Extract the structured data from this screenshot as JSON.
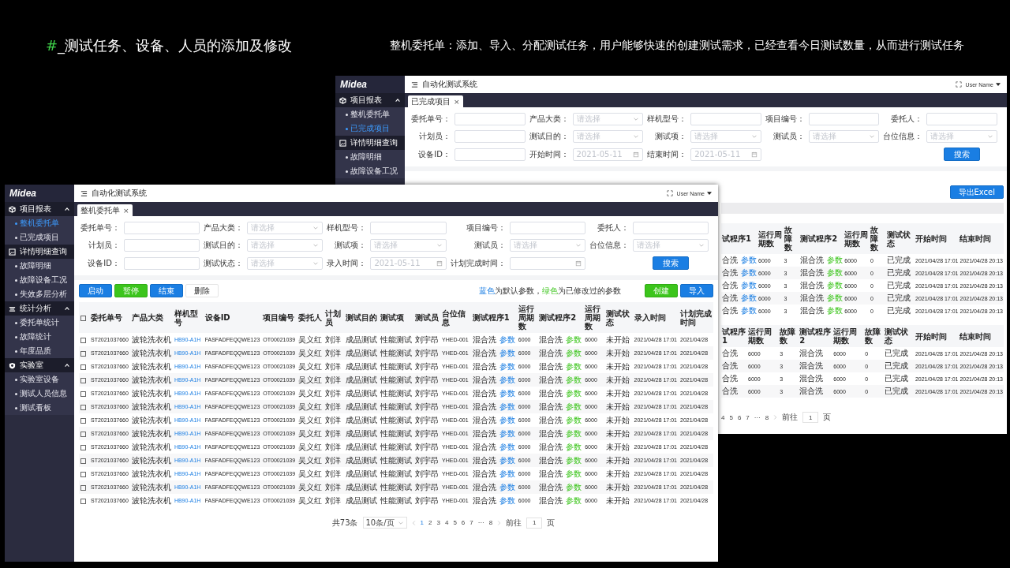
{
  "slide": {
    "title": {
      "mark": "#",
      "text": "_测试任务、设备、人员的添加及修改"
    },
    "description": "整机委托单：添加、导入、分配测试任务，用户能够快速的创建测试需求，已经查看今日测试数量，从而进行测试任务"
  },
  "windows": [
    {
      "kind": "back",
      "logo": "Midea",
      "title": "自动化测试系统",
      "user": "User Name",
      "tab": {
        "label": "已完成项目",
        "close": "×"
      },
      "sidebar": [
        {
          "label": "项目报表",
          "expanded": true,
          "children": [
            {
              "label": "整机委托单",
              "selected": false
            },
            {
              "label": "已完成项目",
              "selected": true
            }
          ]
        },
        {
          "label": "详情明细查询",
          "expanded": true,
          "children": [
            {
              "label": "故障明细",
              "selected": false
            },
            {
              "label": "故障设备工况",
              "selected": false
            }
          ]
        }
      ],
      "form": [
        [
          {
            "label": "委托单号：",
            "kind": "input"
          },
          {
            "label": "产品大类：",
            "kind": "select",
            "placeholder": "请选择"
          },
          {
            "label": "样机型号：",
            "kind": "input"
          },
          {
            "label": "项目编号：",
            "kind": "input"
          },
          {
            "label": "委托人：",
            "kind": "input"
          }
        ],
        [
          {
            "label": "计划员：",
            "kind": "input"
          },
          {
            "label": "测试目的：",
            "kind": "select",
            "placeholder": "请选择"
          },
          {
            "label": "测试项：",
            "kind": "select",
            "placeholder": "请选择"
          },
          {
            "label": "测试员：",
            "kind": "select",
            "placeholder": "请选择"
          },
          {
            "label": "台位信息：",
            "kind": "select",
            "placeholder": "请选择"
          }
        ],
        [
          {
            "label": "设备ID：",
            "kind": "input"
          },
          {
            "label": "开始时间：",
            "kind": "date",
            "placeholder": "2021-05-11"
          },
          {
            "label": "结束时间：",
            "kind": "date",
            "placeholder": "2021-05-11"
          },
          {
            "kind": "blank"
          },
          {
            "label": "搜索",
            "kind": "button"
          }
        ]
      ],
      "export_button": {
        "label": "导出Excel",
        "kind": "primary"
      },
      "tables": [
        {
          "columns": [
            {
              "label": "试程序1",
              "kind": "program"
            },
            {
              "label": "运行周期数",
              "kind": "code"
            },
            {
              "label": "故障数",
              "kind": "code"
            },
            {
              "label": "测试程序2",
              "kind": "program"
            },
            {
              "label": "运行周期数",
              "kind": "code"
            },
            {
              "label": "故障数",
              "kind": "code"
            },
            {
              "label": "测试状态",
              "kind": "text"
            },
            {
              "label": "开始时间",
              "kind": "code"
            },
            {
              "label": "结束时间",
              "kind": "code"
            }
          ],
          "rows": [
            {
              "cells": [
                {
                  "name": "合洗",
                  "param": "参数",
                  "modified": false
                },
                "6000",
                "3",
                {
                  "name": "混合洗",
                  "param": "参数",
                  "modified": true
                },
                "6000",
                "0",
                "已完成",
                "2021/04/28 17:01",
                "2021/04/28 20:13"
              ]
            },
            {
              "cells": [
                {
                  "name": "合洗",
                  "param": "参数",
                  "modified": false
                },
                "6000",
                "3",
                {
                  "name": "混合洗",
                  "param": "参数",
                  "modified": true
                },
                "6000",
                "0",
                "已完成",
                "2021/04/28 17:01",
                "2021/04/28 20:13"
              ]
            },
            {
              "cells": [
                {
                  "name": "合洗",
                  "param": "参数",
                  "modified": false
                },
                "6000",
                "3",
                {
                  "name": "混合洗",
                  "param": "参数",
                  "modified": true
                },
                "6000",
                "0",
                "已完成",
                "2021/04/28 17:01",
                "2021/04/28 20:13"
              ]
            },
            {
              "cells": [
                {
                  "name": "合洗",
                  "param": "参数",
                  "modified": false
                },
                "6000",
                "3",
                {
                  "name": "混合洗",
                  "param": "参数",
                  "modified": true
                },
                "6000",
                "0",
                "已完成",
                "2021/04/28 17:01",
                "2021/04/28 20:13"
              ]
            },
            {
              "cells": [
                {
                  "name": "合洗",
                  "param": "参数",
                  "modified": false
                },
                "6000",
                "3",
                {
                  "name": "混合洗",
                  "param": "参数",
                  "modified": true
                },
                "6000",
                "0",
                "已完成",
                "2021/04/28 17:01",
                "2021/04/28 20:13"
              ]
            }
          ]
        },
        {
          "columns": [
            {
              "label": "试程序1",
              "kind": "text"
            },
            {
              "label": "运行周期数",
              "kind": "code"
            },
            {
              "label": "故障数",
              "kind": "code"
            },
            {
              "label": "测试程序2",
              "kind": "text"
            },
            {
              "label": "运行周期数",
              "kind": "code"
            },
            {
              "label": "故障数",
              "kind": "code"
            },
            {
              "label": "测试状态",
              "kind": "text"
            },
            {
              "label": "开始时间",
              "kind": "code"
            },
            {
              "label": "结束时间",
              "kind": "code"
            }
          ],
          "rows": [
            {
              "cells": [
                "合洗",
                "6000",
                "3",
                "混合洗",
                "6000",
                "0",
                "已完成",
                "2021/04/28 17:01",
                "2021/04/28 20:13"
              ]
            },
            {
              "cells": [
                "合洗",
                "6000",
                "3",
                "混合洗",
                "6000",
                "0",
                "已完成",
                "2021/04/28 17:01",
                "2021/04/28 20:13"
              ]
            },
            {
              "cells": [
                "合洗",
                "6000",
                "3",
                "混合洗",
                "6000",
                "0",
                "已完成",
                "2021/04/28 17:01",
                "2021/04/28 20:13"
              ]
            },
            {
              "cells": [
                "合洗",
                "6000",
                "3",
                "混合洗",
                "6000",
                "0",
                "已完成",
                "2021/04/28 17:01",
                "2021/04/28 20:13"
              ]
            }
          ]
        }
      ],
      "pagination": {
        "prev_arrow": false,
        "pages": [
          {
            "label": "4",
            "selected": false
          },
          {
            "label": "5",
            "selected": false
          },
          {
            "label": "6",
            "selected": false
          },
          {
            "label": "7",
            "selected": false
          },
          {
            "label": "···",
            "selected": false
          },
          {
            "label": "8",
            "selected": false
          }
        ],
        "goto_label": "前往",
        "goto_value": "1",
        "goto_suffix": "页"
      }
    },
    {
      "kind": "front",
      "logo": "Midea",
      "title": "自动化测试系统",
      "user": "User Name",
      "tab": {
        "label": "整机委托单",
        "close": "×"
      },
      "sidebar": [
        {
          "label": "项目报表",
          "expanded": true,
          "children": [
            {
              "label": "整机委托单",
              "selected": true
            },
            {
              "label": "已完成项目",
              "selected": false
            }
          ]
        },
        {
          "label": "详情明细查询",
          "expanded": true,
          "children": [
            {
              "label": "故障明细",
              "selected": false
            },
            {
              "label": "故障设备工况",
              "selected": false
            },
            {
              "label": "失效多层分析",
              "selected": false
            }
          ]
        },
        {
          "label": "统计分析",
          "expanded": true,
          "children": [
            {
              "label": "委托单统计",
              "selected": false
            },
            {
              "label": "故障统计",
              "selected": false
            },
            {
              "label": "年度品质",
              "selected": false
            }
          ]
        },
        {
          "label": "实验室",
          "expanded": true,
          "children": [
            {
              "label": "实验室设备",
              "selected": false
            },
            {
              "label": "测试人员信息",
              "selected": false
            },
            {
              "label": "测试看板",
              "selected": false
            }
          ]
        }
      ],
      "form": [
        [
          {
            "label": "委托单号：",
            "kind": "input"
          },
          {
            "label": "产品大类：",
            "kind": "select",
            "placeholder": "请选择"
          },
          {
            "label": "样机型号：",
            "kind": "input"
          },
          {
            "label": "项目编号：",
            "kind": "input"
          },
          {
            "label": "委托人：",
            "kind": "input"
          }
        ],
        [
          {
            "label": "计划员：",
            "kind": "input"
          },
          {
            "label": "测试目的：",
            "kind": "select",
            "placeholder": "请选择"
          },
          {
            "label": "测试项：",
            "kind": "select",
            "placeholder": "请选择"
          },
          {
            "label": "测试员：",
            "kind": "select",
            "placeholder": "请选择"
          },
          {
            "label": "台位信息：",
            "kind": "select",
            "placeholder": "请选择"
          }
        ],
        [
          {
            "label": "设备ID：",
            "kind": "input"
          },
          {
            "label": "测试状态：",
            "kind": "select",
            "placeholder": "请选择"
          },
          {
            "label": "录入时间：",
            "kind": "date",
            "placeholder": "2021-05-11"
          },
          {
            "label": "计划完成时间：",
            "kind": "date"
          },
          {
            "label": "搜索",
            "kind": "button"
          }
        ]
      ],
      "toolbar": {
        "left": [
          {
            "label": "启动",
            "kind": "primary"
          },
          {
            "label": "暂停",
            "kind": "success"
          },
          {
            "label": "结束",
            "kind": "primary"
          },
          {
            "label": "删除",
            "kind": "default"
          }
        ],
        "legend": [
          {
            "text": "蓝色",
            "kind": "blue"
          },
          {
            "text": "为默认参数，",
            "kind": "plain"
          },
          {
            "text": "绿色",
            "kind": "green"
          },
          {
            "text": "为已修改过的参数",
            "kind": "plain"
          }
        ],
        "right": [
          {
            "label": "创建",
            "kind": "success"
          },
          {
            "label": "导入",
            "kind": "primary"
          }
        ]
      },
      "table": {
        "select_all_checked": false,
        "columns": [
          {
            "label": "委托单号",
            "kind": "code"
          },
          {
            "label": "产品大类",
            "kind": "text"
          },
          {
            "label": "样机型号",
            "kind": "link"
          },
          {
            "label": "设备ID",
            "kind": "code"
          },
          {
            "label": "项目编号",
            "kind": "code"
          },
          {
            "label": "委托人",
            "kind": "text"
          },
          {
            "label": "计划员",
            "kind": "text"
          },
          {
            "label": "测试目的",
            "kind": "text"
          },
          {
            "label": "测试项",
            "kind": "text"
          },
          {
            "label": "测试员",
            "kind": "text"
          },
          {
            "label": "台位信息",
            "kind": "code"
          },
          {
            "label": "测试程序1",
            "kind": "program"
          },
          {
            "label": "运行周期数",
            "kind": "code"
          },
          {
            "label": "测试程序2",
            "kind": "program"
          },
          {
            "label": "运行周期数",
            "kind": "code"
          },
          {
            "label": "测试状态",
            "kind": "text"
          },
          {
            "label": "录入时间",
            "kind": "code"
          },
          {
            "label": "计划完成时间",
            "kind": "code"
          }
        ],
        "rows": [
          {
            "checked": false,
            "cells": [
              "ST2021037660",
              "波轮洗衣机",
              "HB90-A1H",
              "FASFADFEQQWE123",
              "OT00021039",
              "吴义红",
              "刘洋",
              "成品测试",
              "性能测试",
              "刘宇昂",
              "YHED-001",
              {
                "name": "混合洗",
                "param": "参数",
                "modified": false
              },
              "6000",
              {
                "name": "混合洗",
                "param": "参数",
                "modified": true
              },
              "6000",
              "未开始",
              "2021/04/28 17:01",
              "2021/04/28"
            ]
          },
          {
            "checked": false,
            "cells": [
              "ST2021037660",
              "波轮洗衣机",
              "HB90-A1H",
              "FASFADFEQQWE123",
              "OT00021039",
              "吴义红",
              "刘洋",
              "成品测试",
              "性能测试",
              "刘宇昂",
              "YHED-001",
              {
                "name": "混合洗",
                "param": "参数",
                "modified": false
              },
              "6000",
              {
                "name": "混合洗",
                "param": "参数",
                "modified": true
              },
              "6000",
              "未开始",
              "2021/04/28 17:01",
              "2021/04/28"
            ]
          },
          {
            "checked": false,
            "cells": [
              "ST2021037660",
              "波轮洗衣机",
              "HB90-A1H",
              "FASFADFEQQWE123",
              "OT00021039",
              "吴义红",
              "刘洋",
              "成品测试",
              "性能测试",
              "刘宇昂",
              "YHED-001",
              {
                "name": "混合洗",
                "param": "参数",
                "modified": false
              },
              "6000",
              {
                "name": "混合洗",
                "param": "参数",
                "modified": true
              },
              "6000",
              "未开始",
              "2021/04/28 17:01",
              "2021/04/28"
            ]
          },
          {
            "checked": false,
            "cells": [
              "ST2021037660",
              "波轮洗衣机",
              "HB90-A1H",
              "FASFADFEQQWE123",
              "OT00021039",
              "吴义红",
              "刘洋",
              "成品测试",
              "性能测试",
              "刘宇昂",
              "YHED-001",
              {
                "name": "混合洗",
                "param": "参数",
                "modified": false
              },
              "6000",
              {
                "name": "混合洗",
                "param": "参数",
                "modified": true
              },
              "6000",
              "未开始",
              "2021/04/28 17:01",
              "2021/04/28"
            ]
          },
          {
            "checked": false,
            "cells": [
              "ST2021037660",
              "波轮洗衣机",
              "HB90-A1H",
              "FASFADFEQQWE123",
              "OT00021039",
              "吴义红",
              "刘洋",
              "成品测试",
              "性能测试",
              "刘宇昂",
              "YHED-001",
              {
                "name": "混合洗",
                "param": "参数",
                "modified": false
              },
              "6000",
              {
                "name": "混合洗",
                "param": "参数",
                "modified": true
              },
              "6000",
              "未开始",
              "2021/04/28 17:01",
              "2021/04/28"
            ]
          },
          {
            "checked": false,
            "cells": [
              "ST2021037660",
              "波轮洗衣机",
              "HB90-A1H",
              "FASFADFEQQWE123",
              "OT00021039",
              "吴义红",
              "刘洋",
              "成品测试",
              "性能测试",
              "刘宇昂",
              "YHED-001",
              {
                "name": "混合洗",
                "param": "参数",
                "modified": false
              },
              "6000",
              {
                "name": "混合洗",
                "param": "参数",
                "modified": true
              },
              "6000",
              "未开始",
              "2021/04/28 17:01",
              "2021/04/28"
            ]
          },
          {
            "checked": false,
            "cells": [
              "ST2021037660",
              "波轮洗衣机",
              "HB90-A1H",
              "FASFADFEQQWE123",
              "OT00021039",
              "吴义红",
              "刘洋",
              "成品测试",
              "性能测试",
              "刘宇昂",
              "YHED-001",
              {
                "name": "混合洗",
                "param": "参数",
                "modified": false
              },
              "6000",
              {
                "name": "混合洗",
                "param": "参数",
                "modified": true
              },
              "6000",
              "未开始",
              "2021/04/28 17:01",
              "2021/04/28"
            ]
          },
          {
            "checked": false,
            "cells": [
              "ST2021037660",
              "波轮洗衣机",
              "HB90-A1H",
              "FASFADFEQQWE123",
              "OT00021039",
              "吴义红",
              "刘洋",
              "成品测试",
              "性能测试",
              "刘宇昂",
              "YHED-001",
              {
                "name": "混合洗",
                "param": "参数",
                "modified": false
              },
              "6000",
              {
                "name": "混合洗",
                "param": "参数",
                "modified": true
              },
              "6000",
              "未开始",
              "2021/04/28 17:01",
              "2021/04/28"
            ]
          },
          {
            "checked": false,
            "cells": [
              "ST2021037660",
              "波轮洗衣机",
              "HB90-A1H",
              "FASFADFEQQWE123",
              "OT00021039",
              "吴义红",
              "刘洋",
              "成品测试",
              "性能测试",
              "刘宇昂",
              "YHED-001",
              {
                "name": "混合洗",
                "param": "参数",
                "modified": false
              },
              "6000",
              {
                "name": "混合洗",
                "param": "参数",
                "modified": true
              },
              "6000",
              "未开始",
              "2021/04/28 17:01",
              "2021/04/28"
            ]
          },
          {
            "checked": false,
            "cells": [
              "ST2021037660",
              "波轮洗衣机",
              "HB90-A1H",
              "FASFADFEQQWE123",
              "OT00021039",
              "吴义红",
              "刘洋",
              "成品测试",
              "性能测试",
              "刘宇昂",
              "YHED-001",
              {
                "name": "混合洗",
                "param": "参数",
                "modified": false
              },
              "6000",
              {
                "name": "混合洗",
                "param": "参数",
                "modified": true
              },
              "6000",
              "未开始",
              "2021/04/28 17:01",
              "2021/04/28"
            ]
          },
          {
            "checked": false,
            "cells": [
              "ST2021037660",
              "波轮洗衣机",
              "HB90-A1H",
              "FASFADFEQQWE123",
              "OT00021039",
              "吴义红",
              "刘洋",
              "成品测试",
              "性能测试",
              "刘宇昂",
              "YHED-001",
              {
                "name": "混合洗",
                "param": "参数",
                "modified": false
              },
              "6000",
              {
                "name": "混合洗",
                "param": "参数",
                "modified": true
              },
              "6000",
              "未开始",
              "2021/04/28 17:01",
              "2021/04/28"
            ]
          },
          {
            "checked": false,
            "cells": [
              "ST2021037660",
              "波轮洗衣机",
              "HB90-A1H",
              "FASFADFEQQWE123",
              "OT00021039",
              "吴义红",
              "刘洋",
              "成品测试",
              "性能测试",
              "刘宇昂",
              "YHED-001",
              {
                "name": "混合洗",
                "param": "参数",
                "modified": false
              },
              "6000",
              {
                "name": "混合洗",
                "param": "参数",
                "modified": true
              },
              "6000",
              "未开始",
              "2021/04/28 17:01",
              "2021/04/28"
            ]
          },
          {
            "checked": false,
            "cells": [
              "ST2021037660",
              "波轮洗衣机",
              "HB90-A1H",
              "FASFADFEQQWE123",
              "OT00021039",
              "吴义红",
              "刘洋",
              "成品测试",
              "性能测试",
              "刘宇昂",
              "YHED-001",
              {
                "name": "混合洗",
                "param": "参数",
                "modified": false
              },
              "6000",
              {
                "name": "混合洗",
                "param": "参数",
                "modified": true
              },
              "6000",
              "未开始",
              "2021/04/28 17:01",
              "2021/04/28"
            ]
          }
        ]
      },
      "pagination": {
        "total": "共73条",
        "page_size": "10条/页",
        "prev_arrow": true,
        "pages": [
          {
            "label": "1",
            "selected": true
          },
          {
            "label": "2",
            "selected": false
          },
          {
            "label": "3",
            "selected": false
          },
          {
            "label": "4",
            "selected": false
          },
          {
            "label": "5",
            "selected": false
          },
          {
            "label": "6",
            "selected": false
          },
          {
            "label": "7",
            "selected": false
          },
          {
            "label": "···",
            "selected": false
          },
          {
            "label": "8",
            "selected": false
          }
        ],
        "goto_label": "前往",
        "goto_value": "1",
        "goto_suffix": "页"
      }
    }
  ]
}
